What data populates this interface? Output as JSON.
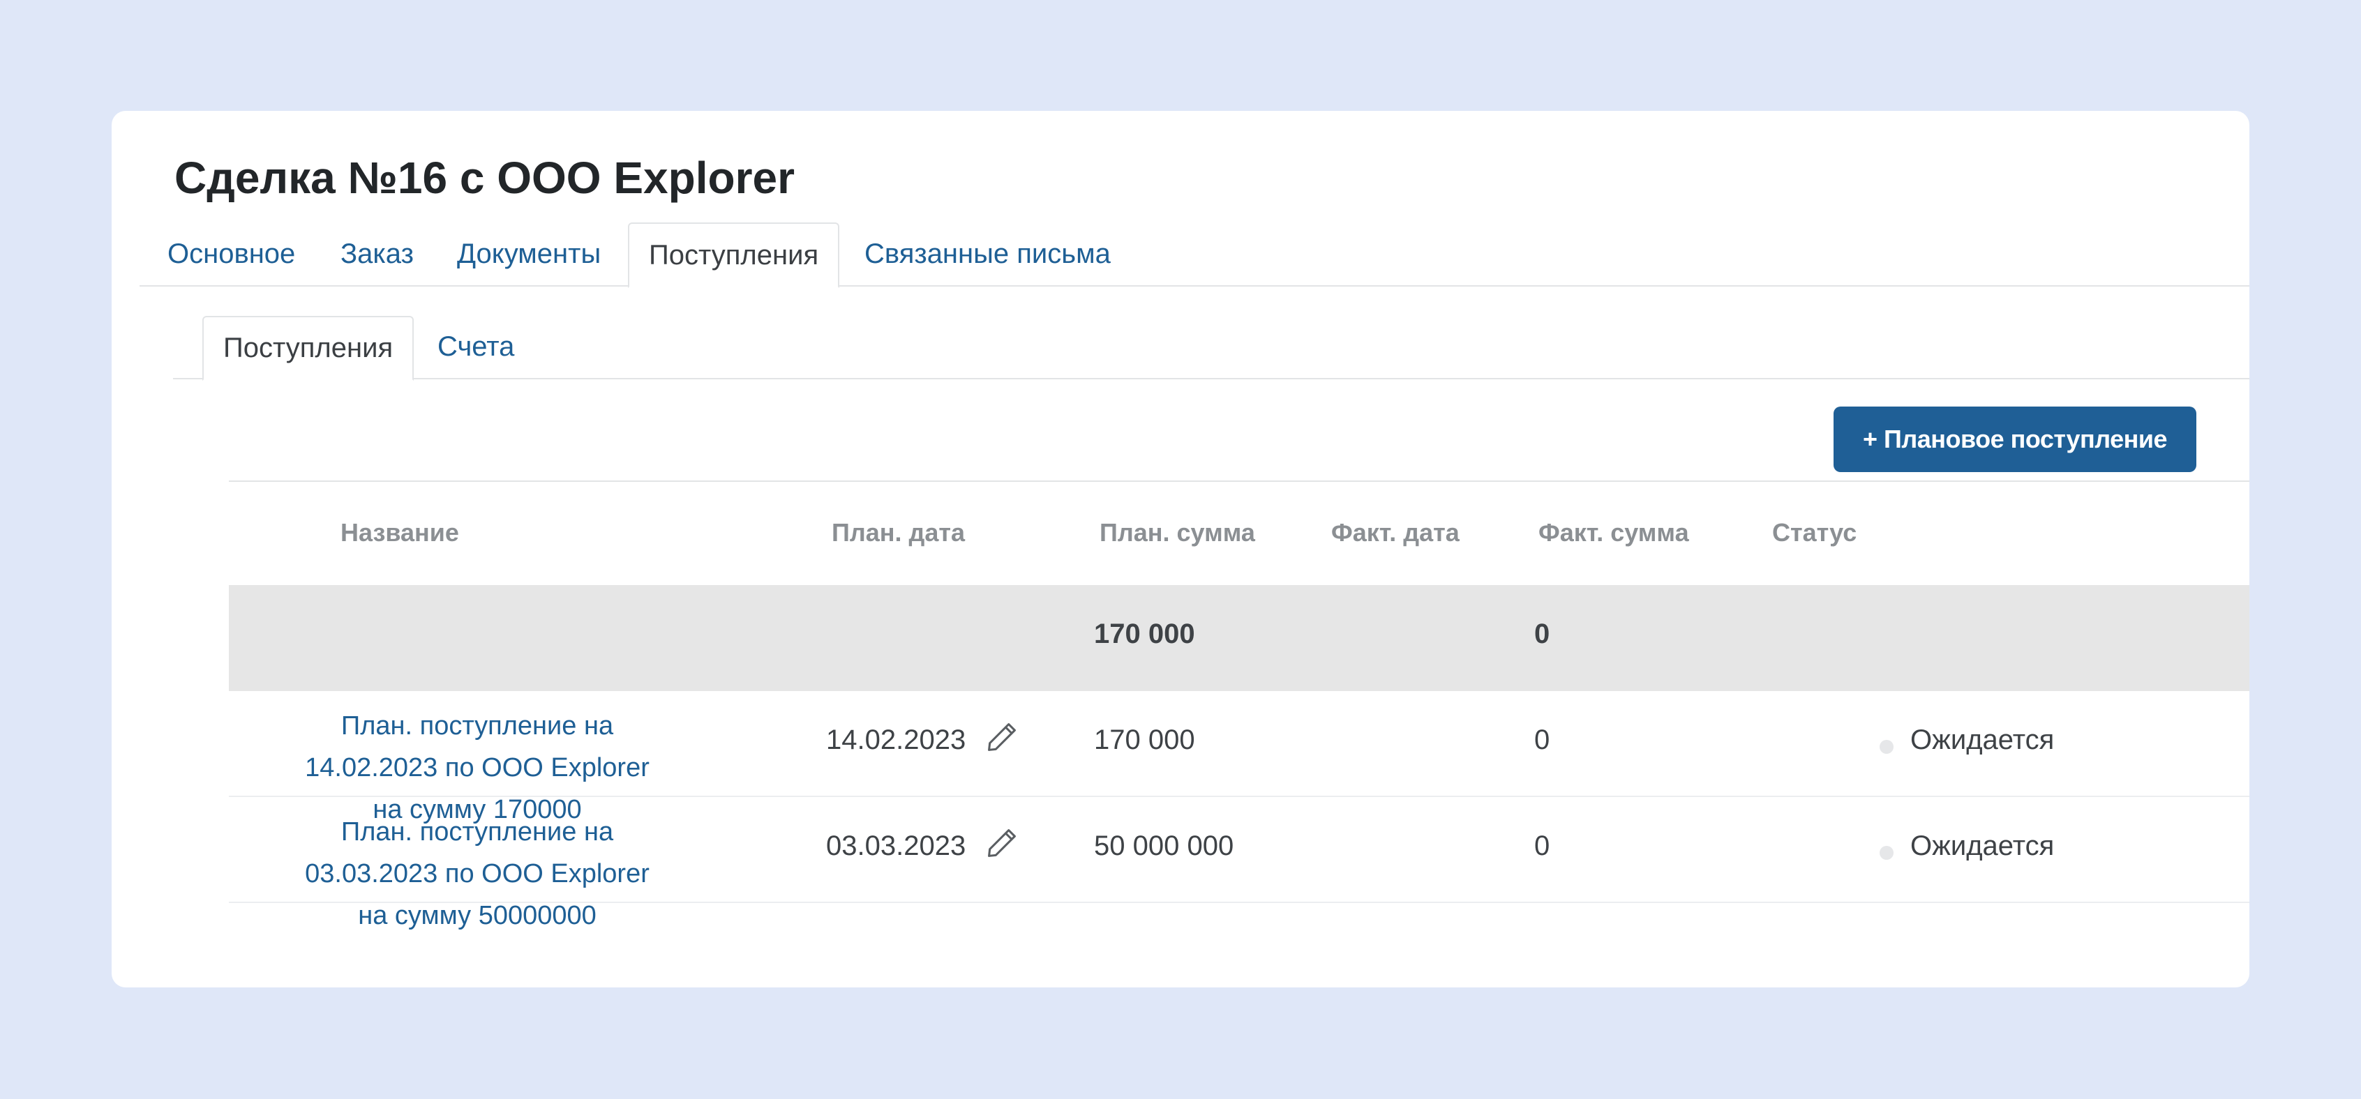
{
  "page": {
    "title": "Сделка №16 с ООО Explorer"
  },
  "main_tabs": [
    {
      "label": "Основное",
      "active": false
    },
    {
      "label": "Заказ",
      "active": false
    },
    {
      "label": "Документы",
      "active": false
    },
    {
      "label": "Поступления",
      "active": true
    },
    {
      "label": "Связанные письма",
      "active": false
    }
  ],
  "sub_tabs": [
    {
      "label": "Поступления",
      "active": true
    },
    {
      "label": "Счета",
      "active": false
    }
  ],
  "actions": {
    "add_planned_label": "+ Плановое поступление"
  },
  "table": {
    "columns": [
      "Название",
      "План. дата",
      "План. сумма",
      "Факт. дата",
      "Факт. сумма",
      "Статус"
    ],
    "summary": {
      "plan_sum": "170 000",
      "fact_sum": "0"
    },
    "rows": [
      {
        "name": "План. поступление на 14.02.2023 по ООО Explorer на сумму 170000",
        "plan_date": "14.02.2023",
        "plan_sum": "170 000",
        "fact_date": "",
        "fact_sum": "0",
        "status": "Ожидается"
      },
      {
        "name": "План. поступление на 03.03.2023 по ООО Explorer на сумму 50000000",
        "plan_date": "03.03.2023",
        "plan_sum": "50 000 000",
        "fact_date": "",
        "fact_sum": "0",
        "status": "Ожидается"
      }
    ]
  },
  "colors": {
    "background": "#dfe7f8",
    "link": "#1e5f95",
    "primary_button": "#1f5f96",
    "summary_row": "#e6e6e6",
    "status_dot": "#e6e7e9"
  },
  "icons": {
    "edit": "pencil-icon"
  }
}
